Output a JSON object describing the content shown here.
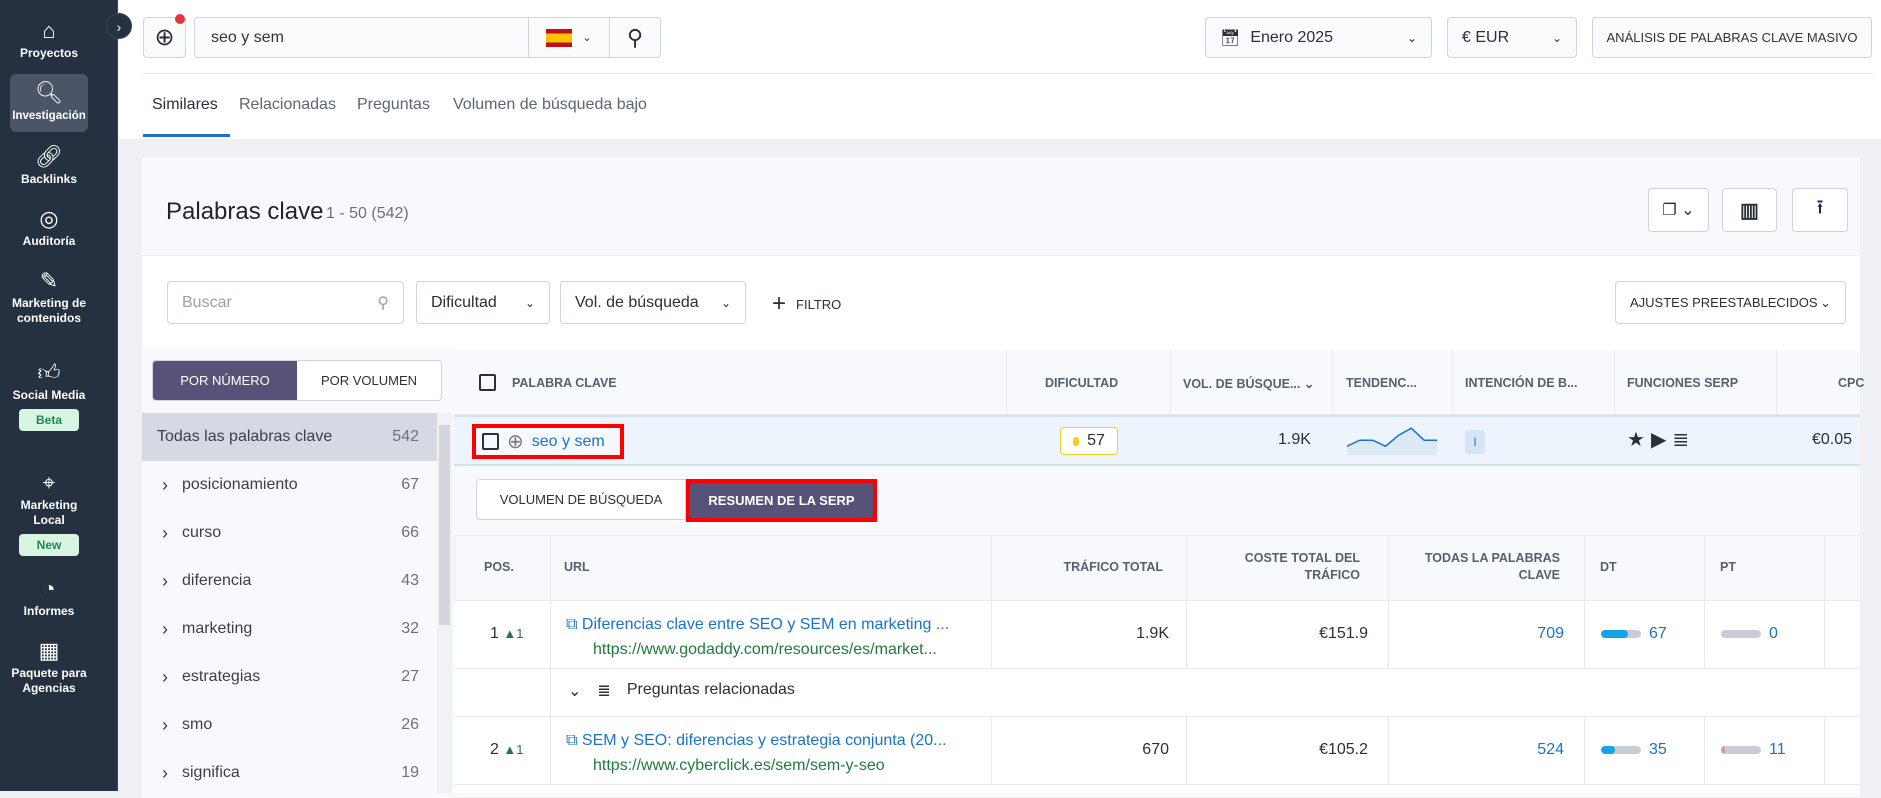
{
  "sidebar": {
    "items": [
      {
        "label": "Proyectos",
        "icon": "home-icon"
      },
      {
        "label": "Investigación",
        "icon": "laptop-search-icon",
        "active": true
      },
      {
        "label": "Backlinks",
        "icon": "link-icon"
      },
      {
        "label": "Auditoría",
        "icon": "check-circle-icon"
      },
      {
        "label": "Marketing de contenidos",
        "icon": "edit-icon"
      },
      {
        "label": "Social Media",
        "icon": "thumbs-up-icon",
        "badge": "Beta"
      },
      {
        "label": "Marketing Local",
        "icon": "location-pin-icon",
        "badge": "New"
      },
      {
        "label": "Informes",
        "icon": "pie-chart-icon"
      },
      {
        "label": "Paquete para Agencias",
        "icon": "building-icon"
      }
    ]
  },
  "search": {
    "value": "seo y sem",
    "country_flag": "ES"
  },
  "header": {
    "date": "Enero 2025",
    "currency": "€ EUR",
    "bulk_button": "ANÁLISIS DE PALABRAS CLAVE MASIVO"
  },
  "tabs": [
    "Similares",
    "Relacionadas",
    "Preguntas",
    "Volumen de búsqueda bajo"
  ],
  "card": {
    "title": "Palabras clave",
    "range": "1 - 50 (542)"
  },
  "filters": {
    "search_placeholder": "Buscar",
    "difficulty": "Dificultad",
    "volume": "Vol. de búsqueda",
    "add_filter": "FILTRO",
    "presets": "AJUSTES PREESTABLECIDOS"
  },
  "groups": {
    "toggle": [
      "POR NÚMERO",
      "POR VOLUMEN"
    ],
    "items": [
      {
        "label": "Todas las palabras clave",
        "count": "542"
      },
      {
        "label": "posicionamiento",
        "count": "67"
      },
      {
        "label": "curso",
        "count": "66"
      },
      {
        "label": "diferencia",
        "count": "43"
      },
      {
        "label": "marketing",
        "count": "32"
      },
      {
        "label": "estrategias",
        "count": "27"
      },
      {
        "label": "smo",
        "count": "26"
      },
      {
        "label": "significa",
        "count": "19"
      }
    ]
  },
  "table": {
    "headers": [
      "PALABRA CLAVE",
      "DIFICULTAD",
      "VOL. DE BÚSQUE...",
      "TENDENC...",
      "INTENCIÓN DE B...",
      "FUNCIONES SERP",
      "CPC"
    ],
    "row": {
      "keyword": "seo y sem",
      "difficulty": "57",
      "volume": "1.9K",
      "intent": "I",
      "cpc": "€0.05",
      "trend": [
        0.8,
        0.55,
        0.55,
        0.8,
        0.35,
        0.05,
        0.55,
        0.55
      ]
    }
  },
  "subtabs": [
    "VOLUMEN DE BÚSQUEDA",
    "RESUMEN DE LA SERP"
  ],
  "serp": {
    "headers": [
      "POS.",
      "URL",
      "TRÁFICO TOTAL",
      "COSTE TOTAL DEL TRÁFICO",
      "TODAS LA PALABRAS CLAVE",
      "DT",
      "PT"
    ],
    "rows": [
      {
        "pos": "1",
        "change": "1",
        "title": "Diferencias clave entre SEO y SEM en marketing ...",
        "url": "https://www.godaddy.com/resources/es/market...",
        "traffic": "1.9K",
        "cost": "€151.9",
        "keywords": "709",
        "dt": 67,
        "pt": 0
      },
      {
        "pos": "2",
        "change": "1",
        "title": "SEM y SEO: diferencias y estrategia conjunta (20...",
        "url": "https://www.cyberclick.es/sem/sem-y-seo",
        "traffic": "670",
        "cost": "€105.2",
        "keywords": "524",
        "dt": 35,
        "pt": 11
      }
    ],
    "related": "Preguntas relacionadas"
  },
  "colors": {
    "accent": "#575278",
    "link": "#1a73c9",
    "highlight": "#ff0000",
    "sidebar": "#253140"
  }
}
